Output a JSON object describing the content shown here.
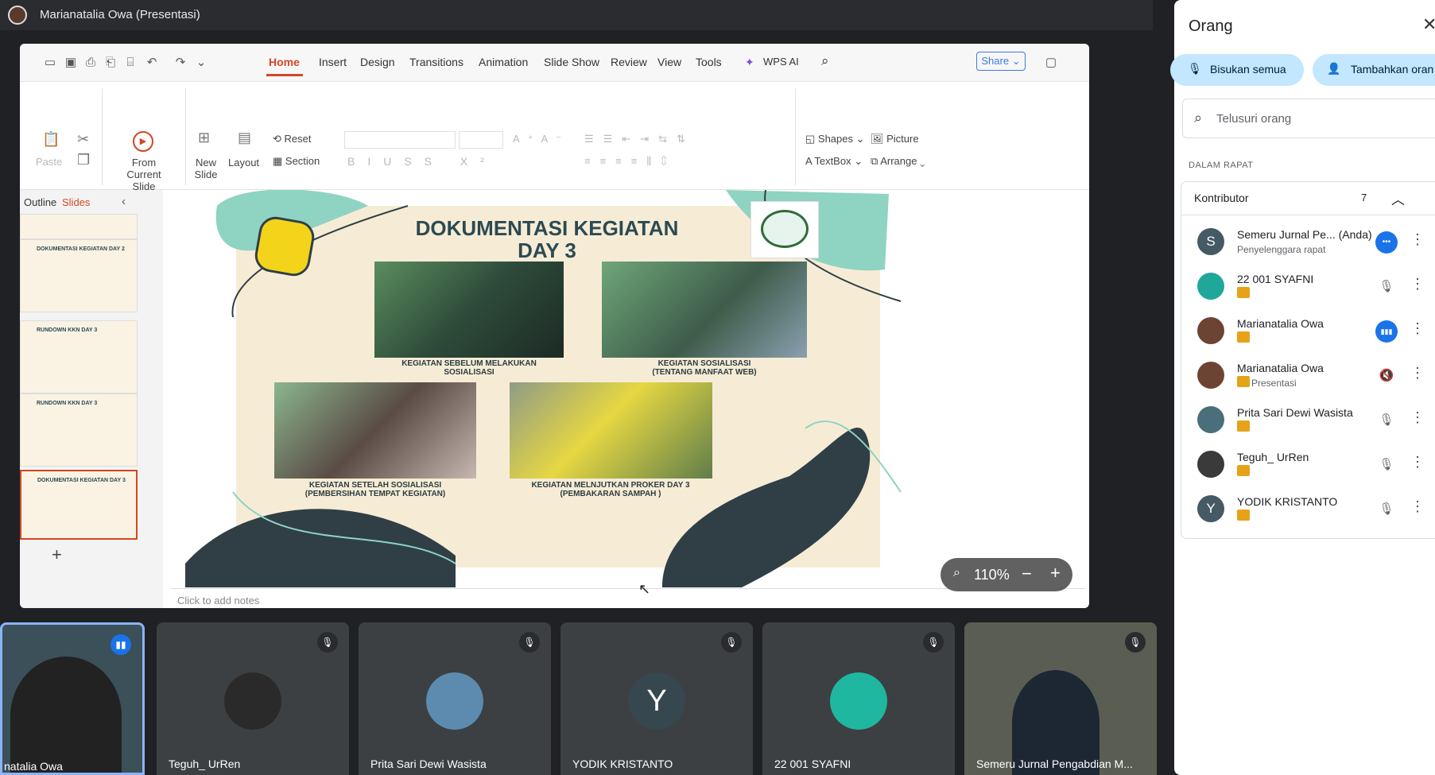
{
  "meeting": {
    "presenter_title": "Marianatalia Owa (Presentasi)"
  },
  "wps": {
    "menu": [
      "Home",
      "Insert",
      "Design",
      "Transitions",
      "Animation",
      "Slide Show",
      "Review",
      "View",
      "Tools"
    ],
    "wps_ai": "WPS AI",
    "share": "Share",
    "ribbon": {
      "paste": "Paste",
      "from_current_slide": "From Current Slide",
      "new_slide": "New Slide",
      "layout": "Layout",
      "reset": "Reset",
      "section": "Section",
      "shapes": "Shapes",
      "picture": "Picture",
      "textbox": "TextBox",
      "arrange": "Arrange"
    },
    "pane_tabs": {
      "outline": "Outline",
      "slides": "Slides"
    },
    "notes_placeholder": "Click to add notes",
    "zoom": "110%"
  },
  "slide": {
    "title_line1": "DOKUMENTASI KEGIATAN",
    "title_line2": "DAY 3",
    "photos": [
      {
        "caption1": "KEGIATAN SEBELUM MELAKUKAN",
        "caption2": "SOSIALISASI"
      },
      {
        "caption1": "KEGIATAN SOSIALISASI",
        "caption2": "(TENTANG MANFAAT WEB)"
      },
      {
        "caption1": "KEGIATAN SETELAH SOSIALISASI",
        "caption2": "(PEMBERSIHAN TEMPAT KEGIATAN)"
      },
      {
        "caption1": "KEGIATAN MELNJUTKAN PROKER DAY 3",
        "caption2": "(PEMBAKARAN SAMPAH )"
      }
    ]
  },
  "thumbnails": [
    {
      "title": ""
    },
    {
      "title": "DOKUMENTASI KEGIATAN DAY 2"
    },
    {
      "title": "RUNDOWN KKN DAY 3"
    },
    {
      "title": "RUNDOWN KKN DAY 3"
    },
    {
      "title": "DOKUMENTASI KEGIATAN DAY 3"
    }
  ],
  "people_panel": {
    "title": "Orang",
    "mute_all": "Bisukan semua",
    "add_people": "Tambahkan oran",
    "search_placeholder": "Telusuri orang",
    "section_label": "DALAM RAPAT",
    "group_label": "Kontributor",
    "group_count": "7",
    "participants": [
      {
        "initial": "S",
        "name": "Semeru Jurnal Pe...",
        "you": "(Anda)",
        "sub": "Penyelenggara rapat",
        "color": "#455a64",
        "status": "more"
      },
      {
        "initial": "",
        "name": "22 001 SYAFNI",
        "sub": "",
        "color": "#1fa79a",
        "status": "muted"
      },
      {
        "initial": "",
        "name": "Marianatalia Owa",
        "sub": "",
        "color": "#6d4434",
        "status": "speaking"
      },
      {
        "initial": "",
        "name": "Marianatalia Owa",
        "sub": "Presentasi",
        "color": "#6d4434",
        "status": "presenting"
      },
      {
        "initial": "",
        "name": "Prita Sari Dewi Wasista",
        "sub": "",
        "color": "#4b6f7a",
        "status": "muted"
      },
      {
        "initial": "",
        "name": "Teguh_ UrRen",
        "sub": "",
        "color": "#3a3a3a",
        "status": "muted"
      },
      {
        "initial": "Y",
        "name": "YODIK KRISTANTO",
        "sub": "",
        "color": "#455a64",
        "status": "muted"
      }
    ]
  },
  "tiles": [
    {
      "name": "natalia Owa"
    },
    {
      "name": "Teguh_ UrRen"
    },
    {
      "name": "Prita Sari Dewi Wasista"
    },
    {
      "name": "YODIK KRISTANTO",
      "initial": "Y"
    },
    {
      "name": "22 001 SYAFNI"
    },
    {
      "name": "Semeru Jurnal Pengabdian M..."
    }
  ],
  "colors": {
    "accent": "#d24726",
    "meet_blue": "#1a73e8",
    "pill": "#c2e7ff",
    "slide_teal": "#8fd3c3",
    "slide_dark": "#2f3f45",
    "slide_bg": "#f6ecd6"
  }
}
